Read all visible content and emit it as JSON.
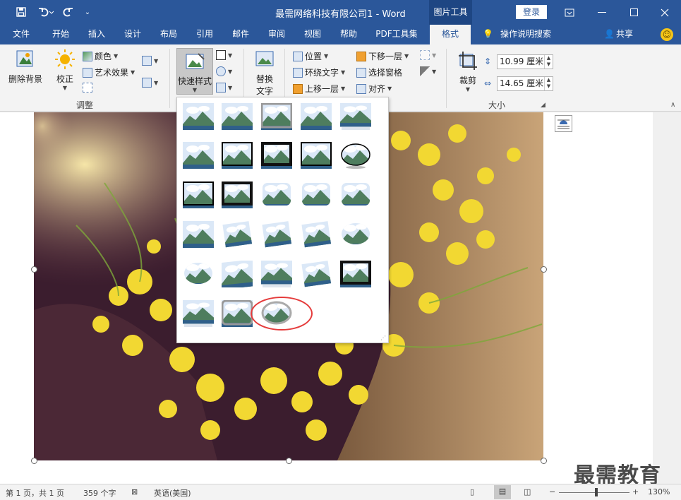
{
  "titlebar": {
    "document_title": "最需网络科技有限公司1  -  Word",
    "context_tab": "图片工具",
    "login": "登录"
  },
  "tabs": [
    "文件",
    "开始",
    "插入",
    "设计",
    "布局",
    "引用",
    "邮件",
    "审阅",
    "视图",
    "帮助",
    "PDF工具集",
    "格式"
  ],
  "active_tab": "格式",
  "tell_me": "操作说明搜索",
  "share": "共享",
  "ribbon": {
    "remove_bg": "删除背景",
    "correct": "校正",
    "color": "颜色",
    "artistic": "艺术效果",
    "adjust_group": "调整",
    "quick_styles": "快速样式",
    "alt_text_line1": "替换",
    "alt_text_line2": "文字",
    "position": "位置",
    "wrap_text": "环绕文字",
    "bring_forward": "上移一层",
    "send_backward": "下移一层",
    "selection_pane": "选择窗格",
    "align": "对齐",
    "crop": "裁剪",
    "height_value": "10.99 厘米",
    "width_value": "14.65 厘米",
    "size_group": "大小"
  },
  "status": {
    "page": "第 1 页，共 1 页",
    "words": "359 个字",
    "language": "英语(美国)",
    "zoom": "130%",
    "minus": "−",
    "plus": "+"
  },
  "watermark": "最需教育",
  "colors": {
    "brand": "#2b579a",
    "highlight_circle": "#e53b3b"
  }
}
